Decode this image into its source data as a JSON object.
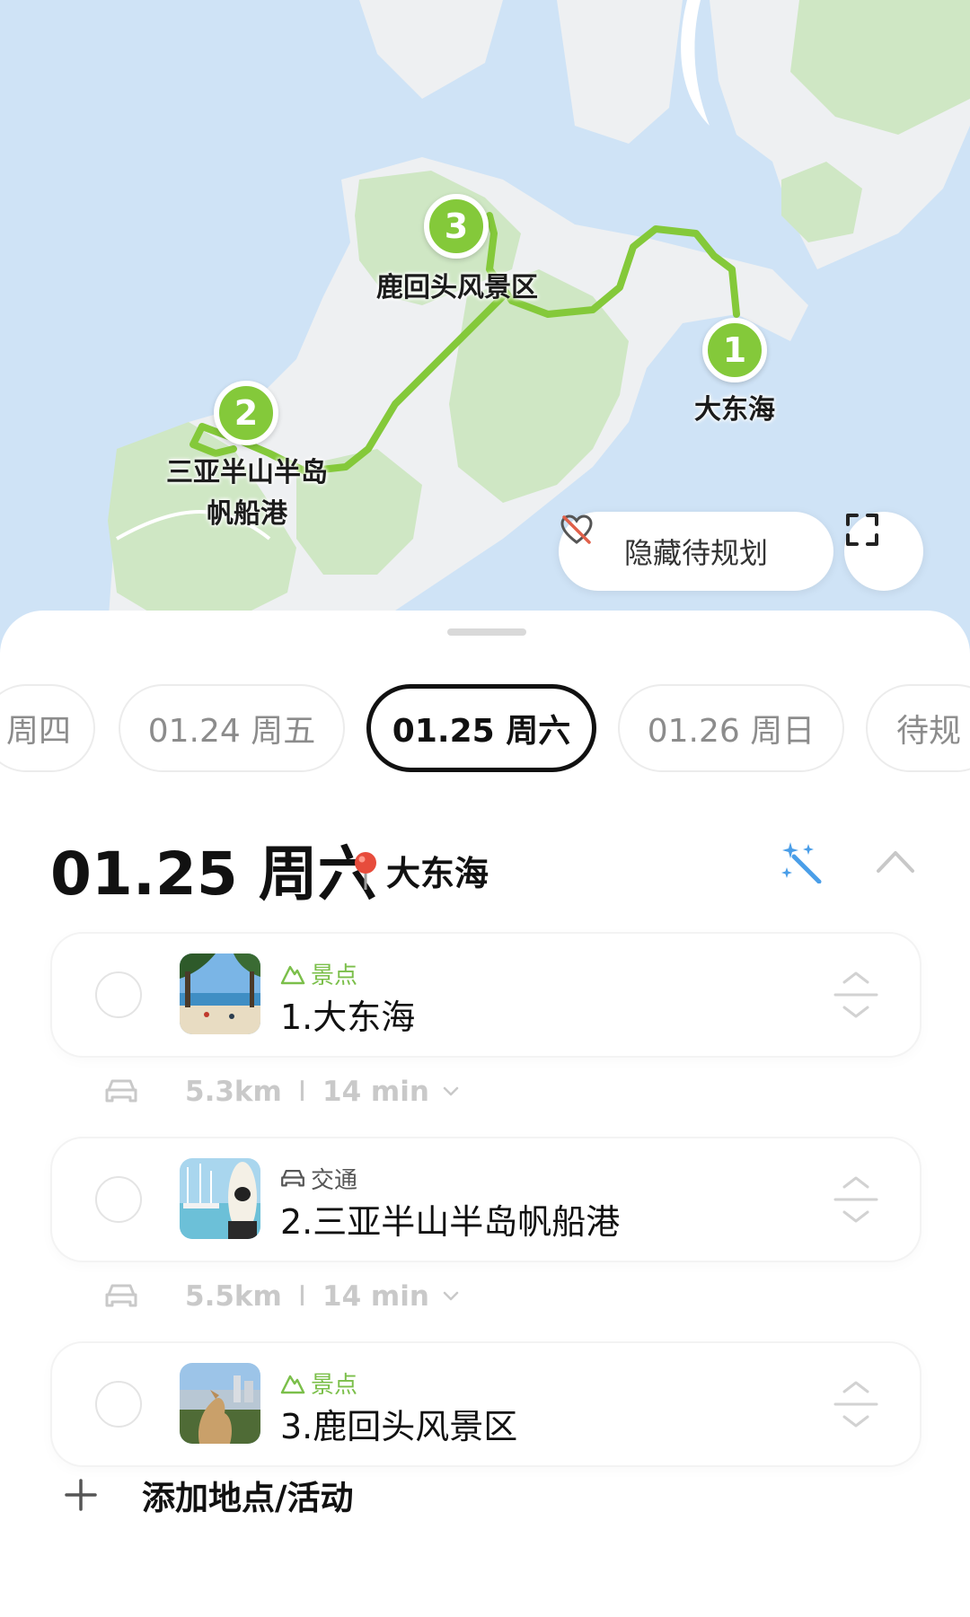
{
  "map": {
    "pins": [
      {
        "number": "1",
        "name": "大东海"
      },
      {
        "number": "2",
        "name": "三亚半山半岛帆船港"
      },
      {
        "number": "3",
        "name": "鹿回头风景区"
      }
    ],
    "labels": {
      "pin1": "大东海",
      "pin2_line1": "三亚半山半岛",
      "pin2_line2": "帆船港",
      "pin3": "鹿回头风景区"
    },
    "hide_button_label": "隐藏待规划",
    "route_color": "#84c93a"
  },
  "date_tabs": [
    {
      "label": "周四",
      "active": false
    },
    {
      "label": "01.24 周五",
      "active": false
    },
    {
      "label": "01.25 周六",
      "active": true
    },
    {
      "label": "01.26 周日",
      "active": false
    },
    {
      "label": "待规",
      "active": false
    }
  ],
  "day": {
    "title": "01.25 周六",
    "location": "大东海"
  },
  "stops": [
    {
      "category": "景点",
      "category_icon": "mountain-icon",
      "name": "1.大东海"
    },
    {
      "category": "交通",
      "category_icon": "car-icon",
      "name": "2.三亚半山半岛帆船港"
    },
    {
      "category": "景点",
      "category_icon": "mountain-icon",
      "name": "3.鹿回头风景区"
    }
  ],
  "routes": [
    {
      "distance": "5.3km",
      "separator": "I",
      "duration": "14 min"
    },
    {
      "distance": "5.5km",
      "separator": "I",
      "duration": "14 min"
    }
  ],
  "add_label": "添加地点/活动",
  "colors": {
    "accent": "#84c93a",
    "scenic": "#7bbf4a",
    "magic": "#4a9ee8",
    "map_water": "#cfe3f6",
    "map_land": "#eef0f2",
    "map_green": "#cfe7c4"
  }
}
